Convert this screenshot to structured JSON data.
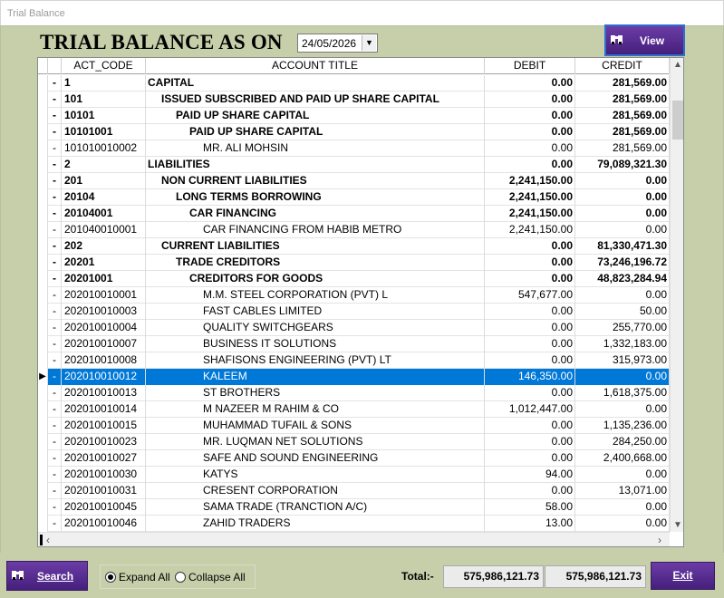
{
  "window": {
    "title": "Trial Balance"
  },
  "header": {
    "title": "TRIAL BALANCE AS ON",
    "date": "24/05/2026"
  },
  "buttons": {
    "view": "View",
    "search": "Search",
    "exit": "Exit"
  },
  "grid": {
    "columns": [
      "ACT_CODE",
      "ACCOUNT TITLE",
      "DEBIT",
      "CREDIT"
    ],
    "rows": [
      {
        "code": "1",
        "title": "CAPITAL",
        "debit": "0.00",
        "credit": "281,569.00",
        "bold": true,
        "level": 0
      },
      {
        "code": "101",
        "title": "ISSUED SUBSCRIBED AND PAID UP SHARE CAPITAL",
        "debit": "0.00",
        "credit": "281,569.00",
        "bold": true,
        "level": 1
      },
      {
        "code": "10101",
        "title": "PAID UP SHARE CAPITAL",
        "debit": "0.00",
        "credit": "281,569.00",
        "bold": true,
        "level": 2
      },
      {
        "code": "10101001",
        "title": "PAID UP SHARE CAPITAL",
        "debit": "0.00",
        "credit": "281,569.00",
        "bold": true,
        "level": 3
      },
      {
        "code": "101010010002",
        "title": "MR. ALI MOHSIN",
        "debit": "0.00",
        "credit": "281,569.00",
        "bold": false,
        "level": 4
      },
      {
        "code": "2",
        "title": "LIABILITIES",
        "debit": "0.00",
        "credit": "79,089,321.30",
        "bold": true,
        "level": 0
      },
      {
        "code": "201",
        "title": "NON CURRENT LIABILITIES",
        "debit": "2,241,150.00",
        "credit": "0.00",
        "bold": true,
        "level": 1
      },
      {
        "code": "20104",
        "title": "LONG TERMS BORROWING",
        "debit": "2,241,150.00",
        "credit": "0.00",
        "bold": true,
        "level": 2
      },
      {
        "code": "20104001",
        "title": "CAR FINANCING",
        "debit": "2,241,150.00",
        "credit": "0.00",
        "bold": true,
        "level": 3
      },
      {
        "code": "201040010001",
        "title": "CAR FINANCING FROM HABIB METRO",
        "debit": "2,241,150.00",
        "credit": "0.00",
        "bold": false,
        "level": 4
      },
      {
        "code": "202",
        "title": "CURRENT LIABILITIES",
        "debit": "0.00",
        "credit": "81,330,471.30",
        "bold": true,
        "level": 1
      },
      {
        "code": "20201",
        "title": "TRADE CREDITORS",
        "debit": "0.00",
        "credit": "73,246,196.72",
        "bold": true,
        "level": 2
      },
      {
        "code": "20201001",
        "title": "CREDITORS FOR GOODS",
        "debit": "0.00",
        "credit": "48,823,284.94",
        "bold": true,
        "level": 3
      },
      {
        "code": "202010010001",
        "title": "M.M. STEEL CORPORATION (PVT) L",
        "debit": "547,677.00",
        "credit": "0.00",
        "bold": false,
        "level": 4
      },
      {
        "code": "202010010003",
        "title": "FAST CABLES LIMITED",
        "debit": "0.00",
        "credit": "50.00",
        "bold": false,
        "level": 4
      },
      {
        "code": "202010010004",
        "title": "QUALITY SWITCHGEARS",
        "debit": "0.00",
        "credit": "255,770.00",
        "bold": false,
        "level": 4
      },
      {
        "code": "202010010007",
        "title": "BUSINESS IT SOLUTIONS",
        "debit": "0.00",
        "credit": "1,332,183.00",
        "bold": false,
        "level": 4
      },
      {
        "code": "202010010008",
        "title": "SHAFISONS ENGINEERING (PVT) LT",
        "debit": "0.00",
        "credit": "315,973.00",
        "bold": false,
        "level": 4
      },
      {
        "code": "202010010012",
        "title": "KALEEM",
        "debit": "146,350.00",
        "credit": "0.00",
        "bold": false,
        "level": 4,
        "selected": true
      },
      {
        "code": "202010010013",
        "title": "ST BROTHERS",
        "debit": "0.00",
        "credit": "1,618,375.00",
        "bold": false,
        "level": 4
      },
      {
        "code": "202010010014",
        "title": "M NAZEER M RAHIM & CO",
        "debit": "1,012,447.00",
        "credit": "0.00",
        "bold": false,
        "level": 4
      },
      {
        "code": "202010010015",
        "title": "MUHAMMAD TUFAIL & SONS",
        "debit": "0.00",
        "credit": "1,135,236.00",
        "bold": false,
        "level": 4
      },
      {
        "code": "202010010023",
        "title": "MR. LUQMAN NET SOLUTIONS",
        "debit": "0.00",
        "credit": "284,250.00",
        "bold": false,
        "level": 4
      },
      {
        "code": "202010010027",
        "title": "SAFE AND SOUND ENGINEERING",
        "debit": "0.00",
        "credit": "2,400,668.00",
        "bold": false,
        "level": 4
      },
      {
        "code": "202010010030",
        "title": "KATYS",
        "debit": "94.00",
        "credit": "0.00",
        "bold": false,
        "level": 4
      },
      {
        "code": "202010010031",
        "title": "CRESENT CORPORATION",
        "debit": "0.00",
        "credit": "13,071.00",
        "bold": false,
        "level": 4
      },
      {
        "code": "202010010045",
        "title": "SAMA TRADE (TRANCTION A/C)",
        "debit": "58.00",
        "credit": "0.00",
        "bold": false,
        "level": 4
      },
      {
        "code": "202010010046",
        "title": "ZAHID TRADERS",
        "debit": "13.00",
        "credit": "0.00",
        "bold": false,
        "level": 4
      }
    ]
  },
  "options": {
    "expand_all": "Expand All",
    "collapse_all": "Collapse All",
    "selected": "expand_all"
  },
  "totals": {
    "label": "Total:-",
    "debit": "575,986,121.73",
    "credit": "575,986,121.73"
  },
  "colors": {
    "accent": "#45207c",
    "frame": "#c6cfaa",
    "selection": "#0078d7"
  }
}
